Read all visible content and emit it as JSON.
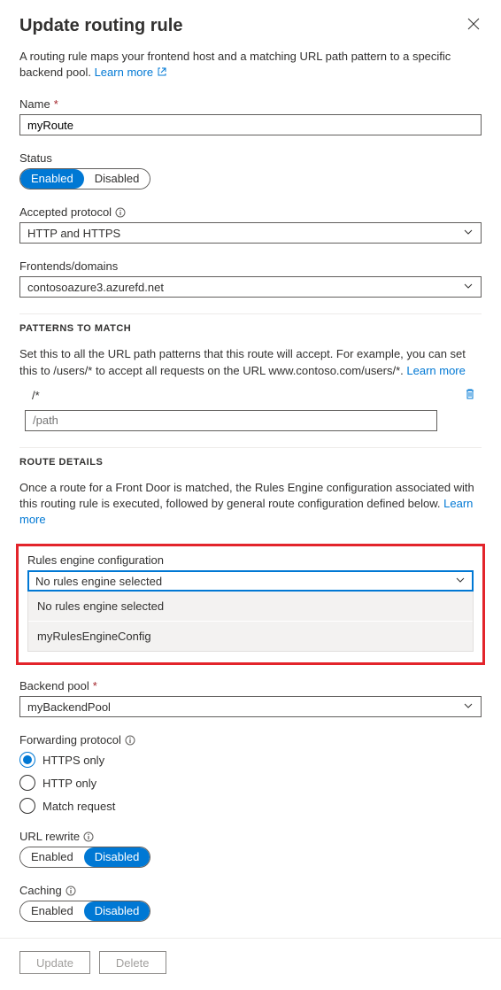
{
  "header": {
    "title": "Update routing rule"
  },
  "intro": {
    "text": "A routing rule maps your frontend host and a matching URL path pattern to a specific backend pool. ",
    "learn_more": "Learn more"
  },
  "name": {
    "label": "Name",
    "value": "myRoute"
  },
  "status": {
    "label": "Status",
    "enabled": "Enabled",
    "disabled": "Disabled"
  },
  "protocol": {
    "label": "Accepted protocol",
    "value": "HTTP and HTTPS"
  },
  "frontends": {
    "label": "Frontends/domains",
    "value": "contosoazure3.azurefd.net"
  },
  "patterns": {
    "title": "PATTERNS TO MATCH",
    "desc": "Set this to all the URL path patterns that this route will accept. For example, you can set this to /users/* to accept all requests on the URL www.contoso.com/users/*. ",
    "learn_more": "Learn more",
    "item": "/*",
    "placeholder": "/path"
  },
  "route_details": {
    "title": "ROUTE DETAILS",
    "desc": "Once a route for a Front Door is matched, the Rules Engine configuration associated with this routing rule is executed, followed by general route configuration defined below. ",
    "learn_more": "Learn more"
  },
  "rules_engine": {
    "label": "Rules engine configuration",
    "value": "No rules engine selected",
    "options": [
      "No rules engine selected",
      "myRulesEngineConfig"
    ]
  },
  "backend_pool": {
    "label": "Backend pool",
    "value": "myBackendPool"
  },
  "forwarding": {
    "label": "Forwarding protocol",
    "options": [
      "HTTPS only",
      "HTTP only",
      "Match request"
    ]
  },
  "url_rewrite": {
    "label": "URL rewrite",
    "enabled": "Enabled",
    "disabled": "Disabled"
  },
  "caching": {
    "label": "Caching",
    "enabled": "Enabled",
    "disabled": "Disabled"
  },
  "footer": {
    "update": "Update",
    "delete": "Delete"
  }
}
